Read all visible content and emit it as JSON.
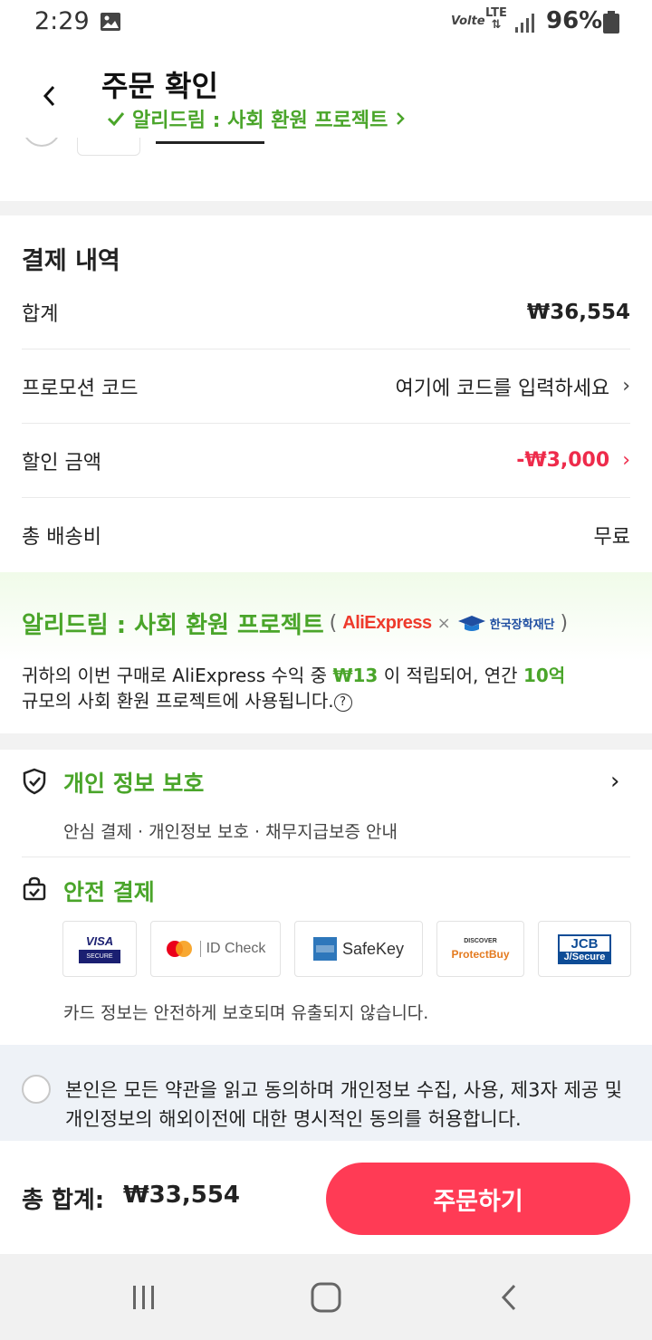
{
  "status_bar": {
    "time": "2:29",
    "volte": "Volte",
    "lte": "LTE",
    "battery": "96%"
  },
  "header": {
    "title": "주문 확인",
    "sub_link": "알리드림 : 사회 환원 프로젝트",
    "back_icon": "chevron-left-icon"
  },
  "payment": {
    "title": "결제 내역",
    "rows": [
      {
        "label": "합계",
        "value": "₩36,554"
      },
      {
        "label": "프로모션 코드",
        "value": "여기에 코드를 입력하세요"
      },
      {
        "label": "할인 금액",
        "value": "-₩3,000"
      },
      {
        "label": "총 배송비",
        "value": "무료"
      }
    ],
    "discount_color": "#ee2b4b"
  },
  "social": {
    "title": "알리드림 : 사회 환원 프로젝트",
    "partner1": "AliExpress",
    "times": "×",
    "partner2": "한국장학재단",
    "desc_part1": "귀하의 이번 구매로 AliExpress 수익 중 ",
    "desc_amount": "₩13",
    "desc_part2": " 이 적립되어, 연간 ",
    "desc_amount2": "10억",
    "desc_part3": "규모의 사회 환원 프로젝트에 사용됩니다.",
    "accent_color": "#4aa52a"
  },
  "privacy": {
    "title": "개인 정보 보호",
    "desc": "안심 결제 · 개인정보 보호 · 채무지급보증 안내"
  },
  "safe_payment": {
    "title": "안전 결제",
    "cards": [
      "VISA SECURE",
      "ID Check",
      "SafeKey",
      "ProtectBuy",
      "JCB J/Secure"
    ],
    "visa_top": "VISA",
    "visa_bottom": "SECURE",
    "mc_label": "ID Check",
    "amex_label": "SafeKey",
    "discover_top": "DISCOVER",
    "discover_label": "ProtectBuy",
    "jcb_top": "JCB",
    "jcb_bottom": "J/Secure",
    "note": "카드 정보는 안전하게 보호되며 유출되지 않습니다."
  },
  "agreement": {
    "text": "본인은 모든 약관을 읽고 동의하며 개인정보 수집, 사용, 제3자 제공 및 개인정보의 해외이전에 대한 명시적인 동의를 허용합니다."
  },
  "bottom": {
    "total_label": "총 합계:",
    "total_value": "₩33,554",
    "order_button": "주문하기",
    "button_color": "#ff3b55"
  }
}
